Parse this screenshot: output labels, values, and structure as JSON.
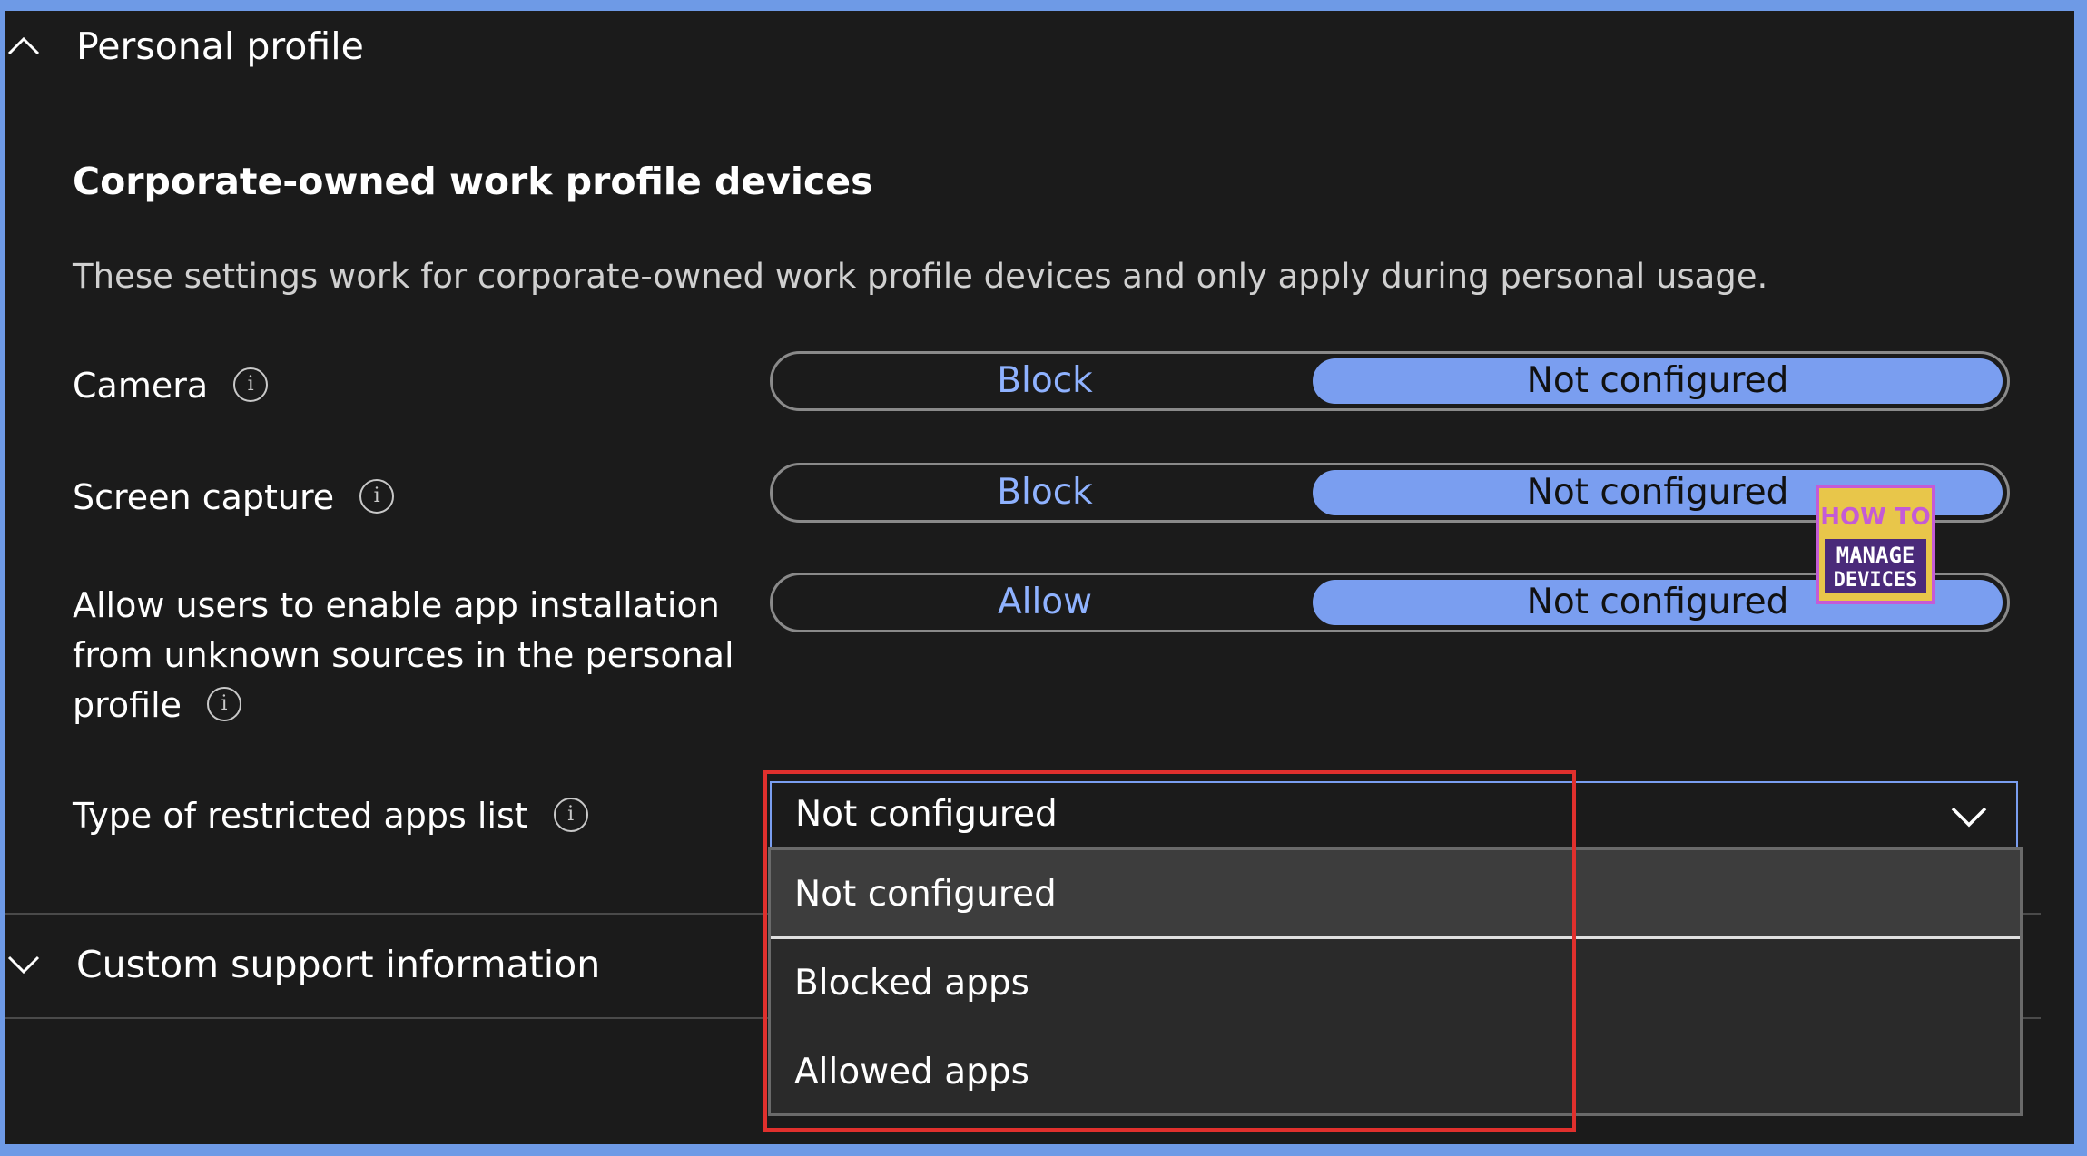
{
  "personal_profile": {
    "header_label": "Personal profile",
    "subheading": "Corporate-owned work profile devices",
    "description": "These settings work for corporate-owned work profile devices and only apply during personal usage.",
    "camera": {
      "label": "Camera",
      "option_left": "Block",
      "option_right": "Not configured",
      "selected": "Not configured"
    },
    "screen_capture": {
      "label": "Screen capture",
      "option_left": "Block",
      "option_right": "Not configured",
      "selected": "Not configured"
    },
    "unknown_sources": {
      "label_line1": "Allow users to enable app installation",
      "label_line2": "from unknown sources in the personal",
      "label_line3": "profile",
      "option_left": "Allow",
      "option_right": "Not configured",
      "selected": "Not configured"
    },
    "restricted_apps": {
      "label": "Type of restricted apps list",
      "value": "Not configured",
      "options": [
        "Not configured",
        "Blocked apps",
        "Allowed apps"
      ],
      "selected_index": 0
    }
  },
  "custom_support": {
    "header_label": "Custom support information"
  },
  "watermark": {
    "line1": "HOW TO",
    "line2": "MANAGE",
    "line3": "DEVICES"
  },
  "colors": {
    "accent": "#7a9ef0",
    "frame": "#6e9ae6",
    "highlight": "#e0302d",
    "background": "#1b1b1b"
  },
  "icons": {
    "collapse": "chevron-up-icon",
    "expand": "chevron-down-icon",
    "info": "info-icon",
    "dropdown_caret": "chevron-down-icon"
  }
}
